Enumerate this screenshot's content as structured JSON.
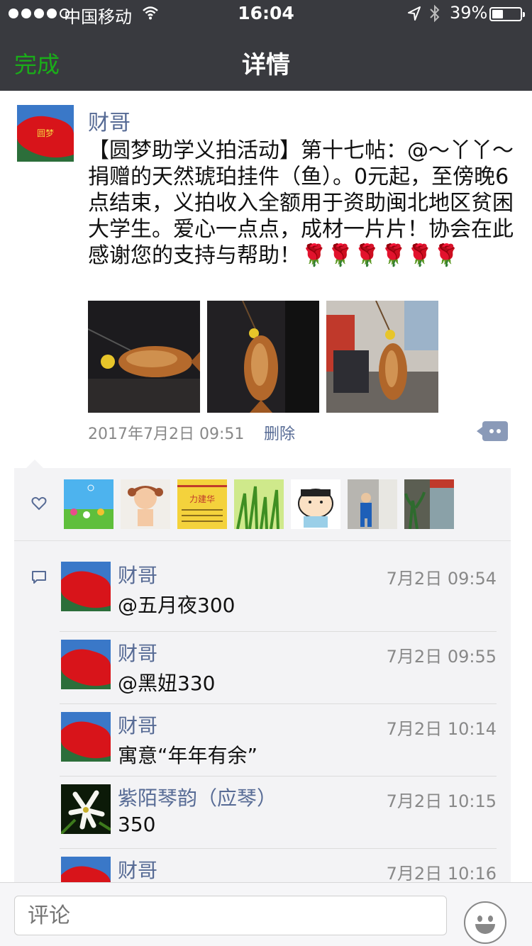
{
  "status": {
    "carrier": "中国移动",
    "time": "16:04",
    "battery_pct": "39%",
    "battery_level": 0.39
  },
  "nav": {
    "done_label": "完成",
    "title": "详情"
  },
  "post": {
    "author": "财哥",
    "text": "【圆梦助学义拍活动】第十七帖：@～丫丫～捐赠的天然琥珀挂件（鱼）。0元起，至傍晚6点结束，义拍收入全额用于资助闽北地区贫困大学生。爱心一点点，成材一片片！协会在此感谢您的支持与帮助！🌹🌹🌹🌹🌹🌹",
    "time": "2017年7月2日 09:51",
    "delete_label": "删除",
    "photos": [
      "amber-fish-photo-1",
      "amber-fish-photo-2",
      "amber-fish-photo-3"
    ]
  },
  "likes": {
    "icon": "heart-icon",
    "avatars": [
      "flowers-avatar",
      "cartoon-girl-avatar",
      "business-card-avatar",
      "grass-avatar",
      "crayon-shin-avatar",
      "child-avatar",
      "shop-avatar"
    ]
  },
  "comments": [
    {
      "name": "财哥",
      "time": "7月2日 09:54",
      "text": "@五月夜300"
    },
    {
      "name": "财哥",
      "time": "7月2日 09:55",
      "text": "@黑妞330"
    },
    {
      "name": "财哥",
      "time": "7月2日 10:14",
      "text": "寓意“年年有余”"
    },
    {
      "name": "紫陌琴韵（应琴）",
      "time": "7月2日 10:15",
      "text": "350"
    },
    {
      "name": "财哥",
      "time": "7月2日 10:16",
      "text": ""
    }
  ],
  "input": {
    "placeholder": "评论"
  },
  "colors": {
    "nav_bg": "#393a3f",
    "accent_green": "#1aad19",
    "link_blue": "#576b95"
  }
}
